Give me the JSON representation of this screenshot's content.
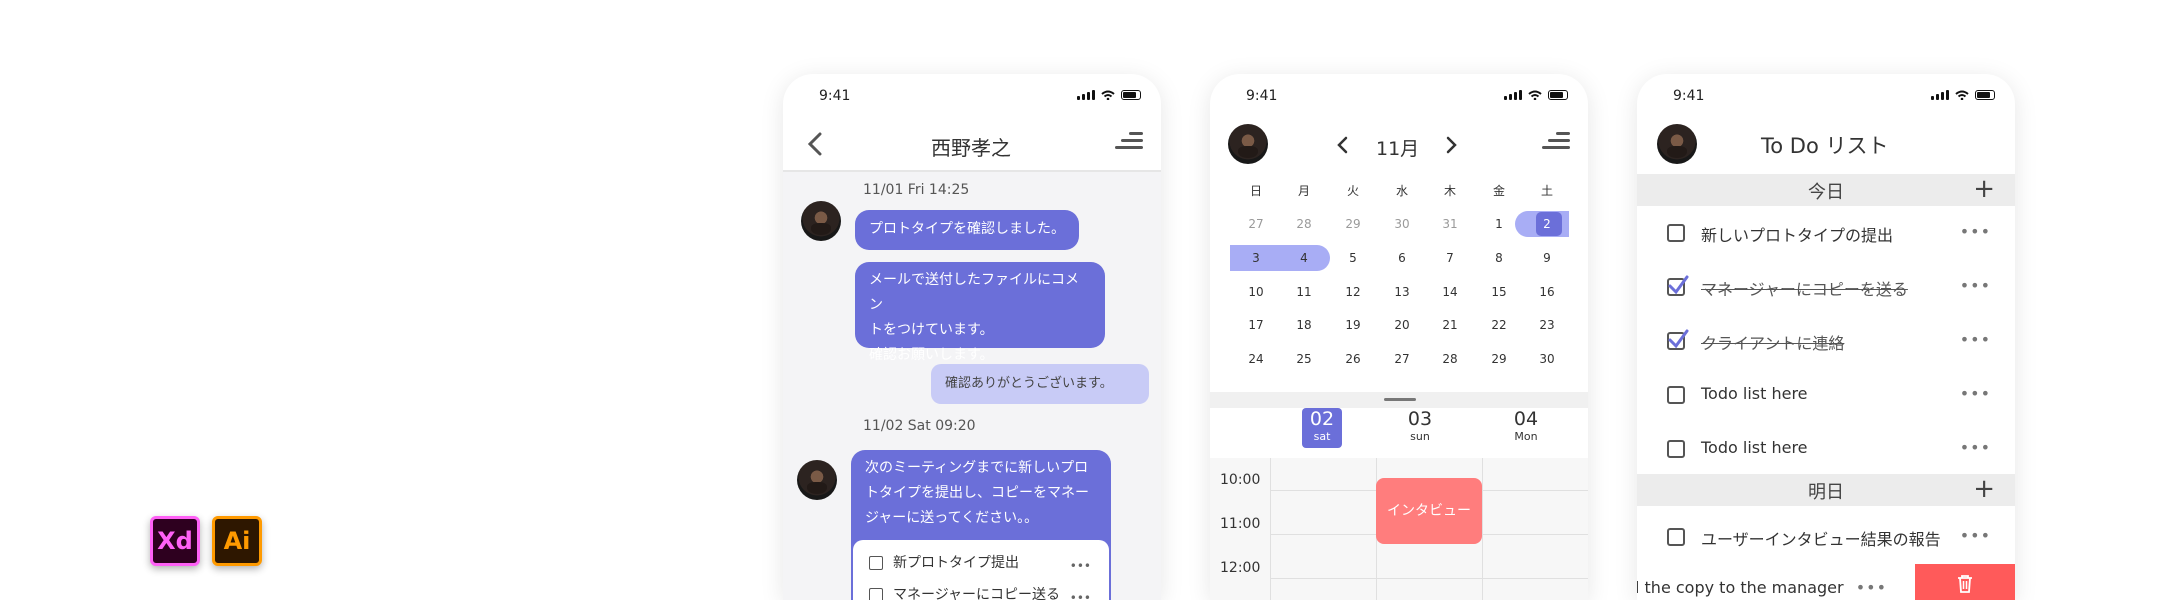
{
  "badges": {
    "xd": "Xd",
    "ai": "Ai"
  },
  "status_time": "9:41",
  "chat": {
    "title": "西野孝之",
    "msgs": {
      "date1": "11/01 Fri 14:25",
      "m1": "プロトタイプを確認しました。",
      "m2_line1": "メールで送付したファイルにコメン",
      "m2_line2": "トをつけています。",
      "m2_line3": "確認お願いします。",
      "reply": "確認ありがとうございます。",
      "date2": "11/02 Sat 09:20",
      "m3_line1": "次のミーティングまでに新しいプロ",
      "m3_line2": "トタイプを提出し、コピーをマネー",
      "m3_line3": "ジャーに送ってください。。",
      "task1": "新プロトタイプ提出",
      "task2": "マネージャーにコピー送る",
      "task_more": "•••"
    }
  },
  "calendar": {
    "month": "11月",
    "weekdays": [
      "日",
      "月",
      "火",
      "水",
      "木",
      "金",
      "土"
    ],
    "rows": [
      [
        "27",
        "28",
        "29",
        "30",
        "31",
        "1",
        "2"
      ],
      [
        "3",
        "4",
        "5",
        "6",
        "7",
        "8",
        "9"
      ],
      [
        "10",
        "11",
        "12",
        "13",
        "14",
        "15",
        "16"
      ],
      [
        "17",
        "18",
        "19",
        "20",
        "21",
        "22",
        "23"
      ],
      [
        "24",
        "25",
        "26",
        "27",
        "28",
        "29",
        "30"
      ]
    ],
    "days": [
      {
        "num": "02",
        "name": "sat"
      },
      {
        "num": "03",
        "name": "sun"
      },
      {
        "num": "04",
        "name": "Mon"
      }
    ],
    "times": [
      "10:00",
      "11:00",
      "12:00"
    ],
    "event": "インタビュー"
  },
  "todo": {
    "title": "To Do リスト",
    "today": "今日",
    "tomorrow": "明日",
    "plus": "+",
    "more": "•••",
    "items_today": [
      "新しいプロトタイプの提出",
      "マネージャーにコピーを送る",
      "クライアントに連絡",
      "Todo list here",
      "Todo list here"
    ],
    "items_tomorrow": [
      "ユーザーインタビュー結果の報告"
    ],
    "swiped": "l the copy to the manager"
  },
  "colors": {
    "accent": "#6b6fd9",
    "light_accent": "#c8cbf6",
    "event": "#ff7d7d",
    "delete": "#ff5a5a"
  }
}
